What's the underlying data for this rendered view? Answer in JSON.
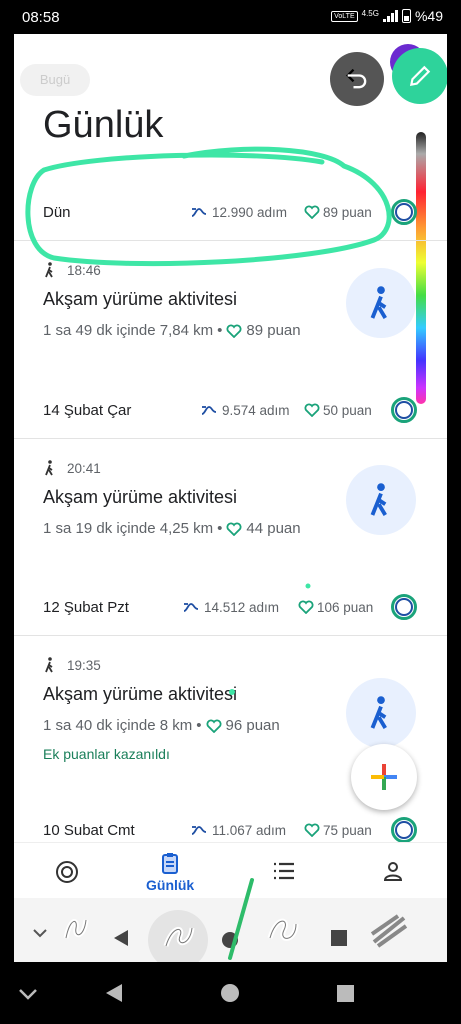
{
  "status": {
    "time": "08:58",
    "volte": "VoLTE",
    "network": "4.5G",
    "battery": "%49"
  },
  "header": {
    "ghost_chip": "Bugü",
    "title": "Günlük"
  },
  "days": [
    {
      "label": "Dün",
      "steps": "12.990 adım",
      "points": "89 puan"
    },
    {
      "label": "14 Şubat Çar",
      "steps": "9.574 adım",
      "points": "50 puan"
    },
    {
      "label": "12 Şubat Pzt",
      "steps": "14.512 adım",
      "points": "106 puan"
    },
    {
      "label": "10 Subat Cmt",
      "steps": "11.067 adım",
      "points": "75 puan"
    }
  ],
  "activities": [
    {
      "time": "18:46",
      "title": "Akşam yürüme aktivitesi",
      "summary": "1 sa 49 dk içinde 7,84 km",
      "points": "89 puan"
    },
    {
      "time": "20:41",
      "title": "Akşam yürüme aktivitesi",
      "summary": "1 sa 19 dk içinde 4,25 km",
      "points": "44 puan"
    },
    {
      "time": "19:35",
      "title": "Akşam yürüme aktivitesi",
      "summary": "1 sa 40 dk içinde 8 km",
      "points": "96 puan",
      "bonus": "Ek puanlar kazanıldı"
    }
  ],
  "bottom_nav": {
    "active_label": "Günlük"
  },
  "colors": {
    "accent_green": "#1aa37a",
    "nav_blue": "#1a5fd0",
    "fab_edit": "#2ed39b"
  }
}
